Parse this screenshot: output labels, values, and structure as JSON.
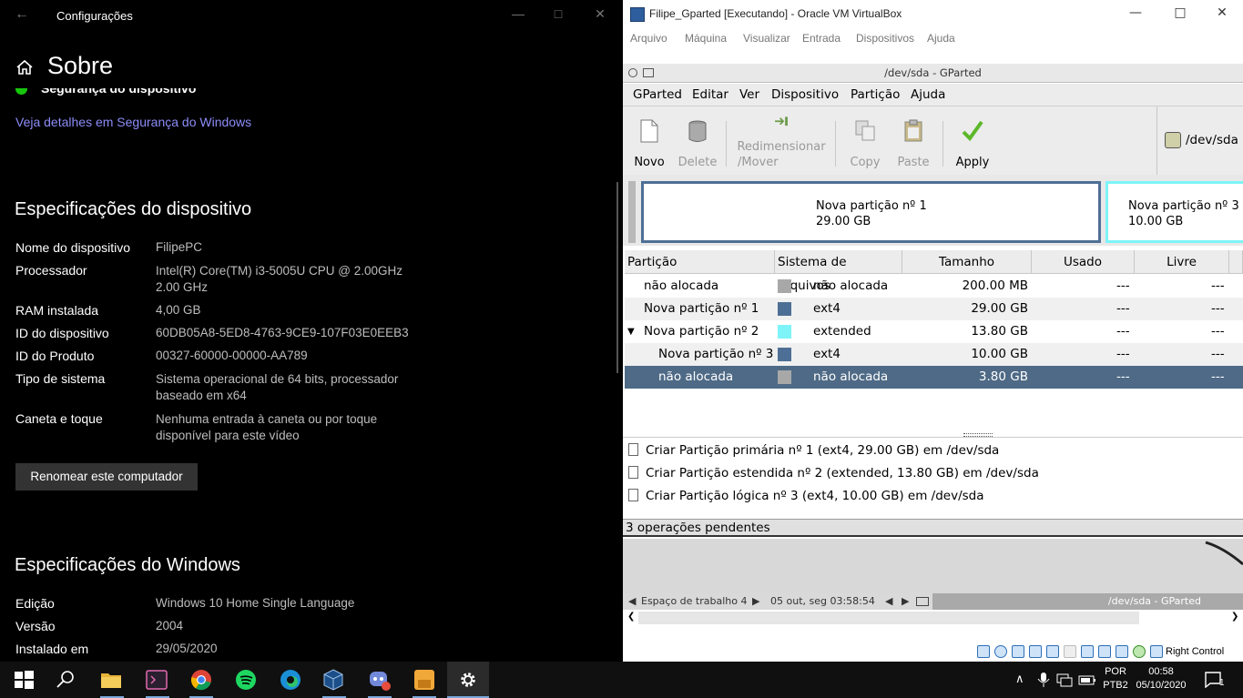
{
  "settings": {
    "window_title": "Configurações",
    "page_title": "Sobre",
    "security_item": "Segurança do dispositivo",
    "security_link": "Veja detalhes em Segurança do Windows",
    "device_specs_heading": "Especificações do dispositivo",
    "device_specs": [
      {
        "label": "Nome do dispositivo",
        "value": "FilipePC"
      },
      {
        "label": "Processador",
        "value": "Intel(R) Core(TM) i3-5005U CPU @ 2.00GHz",
        "value2": "2.00 GHz"
      },
      {
        "label": "RAM instalada",
        "value": "4,00 GB"
      },
      {
        "label": "ID do dispositivo",
        "value": "60DB05A8-5ED8-4763-9CE9-107F03E0EEB3"
      },
      {
        "label": "ID do Produto",
        "value": "00327-60000-00000-AA789"
      },
      {
        "label": "Tipo de sistema",
        "value": "Sistema operacional de 64 bits, processador",
        "value2": "baseado em x64"
      },
      {
        "label": "Caneta e toque",
        "value": "Nenhuma entrada à caneta ou por toque",
        "value2": "disponível para este vídeo"
      }
    ],
    "rename_button": "Renomear este computador",
    "windows_specs_heading": "Especificações do Windows",
    "windows_specs": [
      {
        "label": "Edição",
        "value": "Windows 10 Home Single Language"
      },
      {
        "label": "Versão",
        "value": "2004"
      },
      {
        "label": "Instalado em",
        "value": "29/05/2020"
      }
    ]
  },
  "vbox": {
    "window_title": "Filipe_Gparted [Executando] - Oracle VM VirtualBox",
    "menu": [
      "Arquivo",
      "Máquina",
      "Visualizar",
      "Entrada",
      "Dispositivos",
      "Ajuda"
    ],
    "right_control": "Right Control"
  },
  "gparted": {
    "title": "/dev/sda - GParted",
    "menu": [
      "GParted",
      "Editar",
      "Ver",
      "Dispositivo",
      "Partição",
      "Ajuda"
    ],
    "toolbar": {
      "new": "Novo",
      "delete": "Delete",
      "resize1": "Redimensionar",
      "resize2": "/Mover",
      "copy": "Copy",
      "paste": "Paste",
      "apply": "Apply"
    },
    "device": "/dev/sda",
    "diskmap": [
      {
        "name": "Nova partição nº 1",
        "size": "29.00 GB"
      },
      {
        "name": "Nova partição nº 3",
        "size": "10.00 GB"
      }
    ],
    "columns": [
      "Partição",
      "Sistema de arquivos",
      "Tamanho",
      "Usado",
      "Livre"
    ],
    "rows": [
      {
        "partition": "não alocada",
        "fs": "não alocada",
        "size": "200.00 MB",
        "used": "---",
        "free": "---",
        "color": "#a8a8a8"
      },
      {
        "partition": "Nova partição nº 1",
        "fs": "ext4",
        "size": "29.00 GB",
        "used": "---",
        "free": "---",
        "color": "#4e6f95"
      },
      {
        "partition": "Nova partição nº 2",
        "fs": "extended",
        "size": "13.80 GB",
        "used": "---",
        "free": "---",
        "color": "#7ef4f8"
      },
      {
        "partition": "Nova partição nº 3",
        "fs": "ext4",
        "size": "10.00 GB",
        "used": "---",
        "free": "---",
        "color": "#4e6f95"
      },
      {
        "partition": "não alocada",
        "fs": "não alocada",
        "size": "3.80 GB",
        "used": "---",
        "free": "---",
        "color": "#a8a8a8"
      }
    ],
    "operations": [
      "Criar Partição primária nº 1 (ext4, 29.00 GB) em /dev/sda",
      "Criar Partição estendida nº 2 (extended, 13.80 GB) em /dev/sda",
      "Criar Partição lógica nº 3 (ext4, 10.00 GB) em /dev/sda"
    ],
    "status": "3 operações pendentes",
    "guest_taskbar": {
      "workspace": "Espaço de trabalho 4",
      "clock": "05 out, seg 03:58:54",
      "task": "/dev/sda - GParted"
    }
  },
  "taskbar": {
    "lang1": "POR",
    "lang2": "PTB2",
    "time": "00:58",
    "date": "05/10/2020",
    "notif_count": "1"
  }
}
